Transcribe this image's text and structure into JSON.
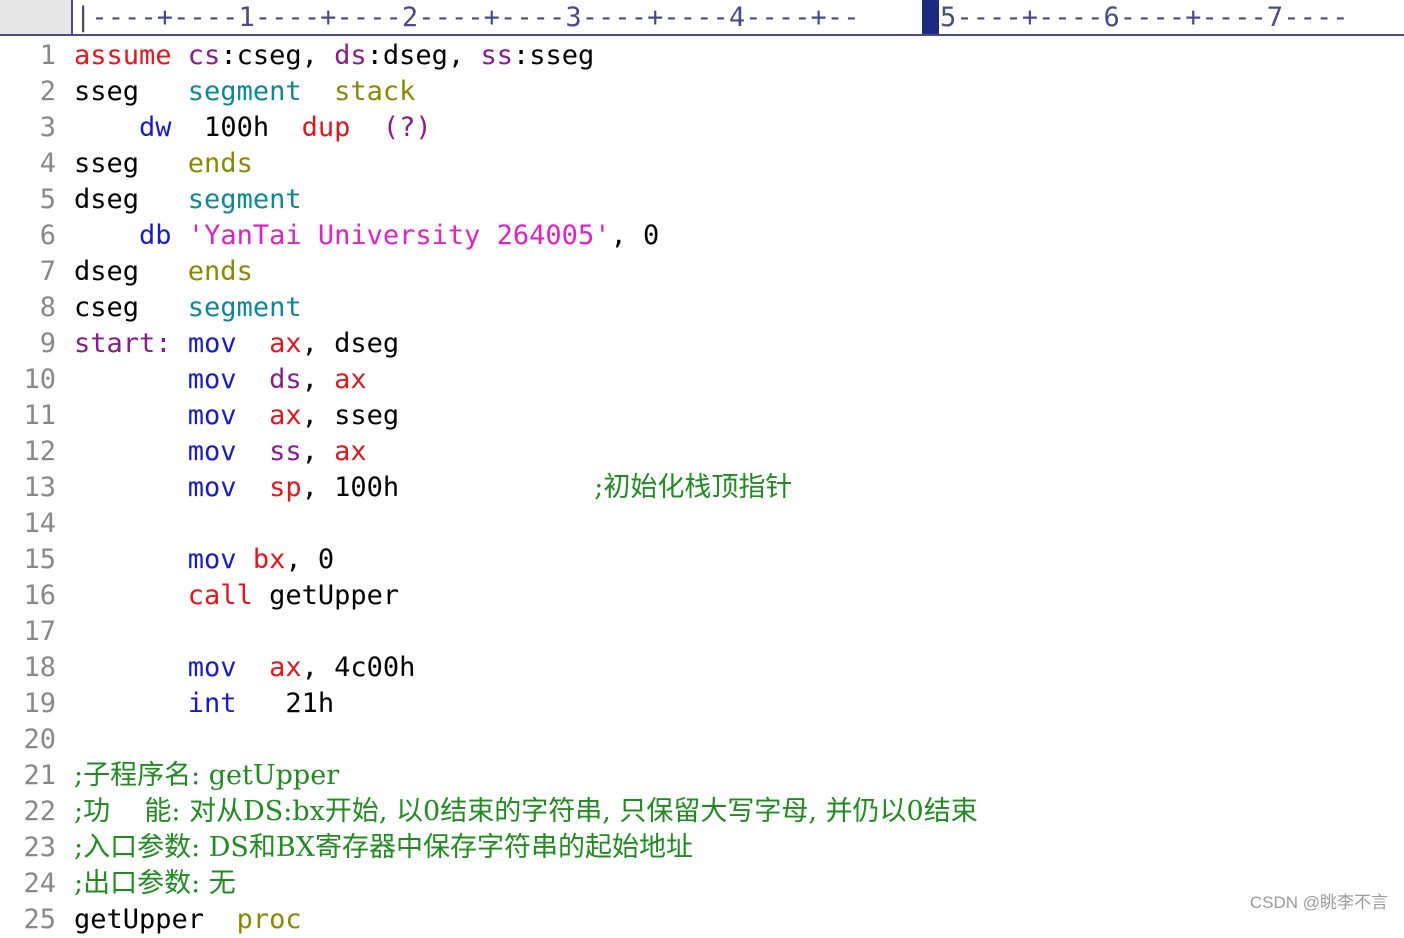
{
  "ruler": {
    "text": "|----+----1----+----2----+----3----+----4----+--",
    "text_after": "5----+----6----+----7----"
  },
  "colors": {
    "default": "#000000",
    "red": "#e8141c",
    "keyword": "#8a1a8c",
    "teal": "#0b8a96",
    "olive": "#8a8a00",
    "blue": "#1a1acc",
    "magenta": "#e020c8",
    "comment": "#1e8c1e",
    "line_number": "#888888"
  },
  "lines": [
    {
      "n": "1",
      "indent": 0,
      "tokens": [
        {
          "t": "assume",
          "c": "red"
        },
        {
          "t": " cs",
          "c": "keyword"
        },
        {
          "t": ":cseg",
          "c": "default"
        },
        {
          "t": ",",
          "c": "default"
        },
        {
          "t": " ds",
          "c": "keyword"
        },
        {
          "t": ":dseg",
          "c": "default"
        },
        {
          "t": ",",
          "c": "default"
        },
        {
          "t": " ss",
          "c": "keyword"
        },
        {
          "t": ":sseg",
          "c": "default"
        }
      ]
    },
    {
      "n": "2",
      "indent": 0,
      "tokens": [
        {
          "t": "sseg   ",
          "c": "default"
        },
        {
          "t": "segment",
          "c": "teal"
        },
        {
          "t": "  ",
          "c": "default"
        },
        {
          "t": "stack",
          "c": "olive"
        }
      ]
    },
    {
      "n": "3",
      "indent": 4,
      "tokens": [
        {
          "t": "dw",
          "c": "blue"
        },
        {
          "t": "  100h  ",
          "c": "default"
        },
        {
          "t": "dup",
          "c": "red"
        },
        {
          "t": "  ",
          "c": "default"
        },
        {
          "t": "(?)",
          "c": "keyword"
        }
      ]
    },
    {
      "n": "4",
      "indent": 0,
      "tokens": [
        {
          "t": "sseg   ",
          "c": "default"
        },
        {
          "t": "ends",
          "c": "olive"
        }
      ]
    },
    {
      "n": "5",
      "indent": 0,
      "tokens": [
        {
          "t": "dseg   ",
          "c": "default"
        },
        {
          "t": "segment",
          "c": "teal"
        }
      ]
    },
    {
      "n": "6",
      "indent": 4,
      "tokens": [
        {
          "t": "db",
          "c": "blue"
        },
        {
          "t": " ",
          "c": "default"
        },
        {
          "t": "'YanTai University 264005'",
          "c": "magenta"
        },
        {
          "t": ", 0",
          "c": "default"
        }
      ]
    },
    {
      "n": "7",
      "indent": 0,
      "tokens": [
        {
          "t": "dseg   ",
          "c": "default"
        },
        {
          "t": "ends",
          "c": "olive"
        }
      ]
    },
    {
      "n": "8",
      "indent": 0,
      "tokens": [
        {
          "t": "cseg   ",
          "c": "default"
        },
        {
          "t": "segment",
          "c": "teal"
        }
      ]
    },
    {
      "n": "9",
      "indent": 0,
      "tokens": [
        {
          "t": "start:",
          "c": "keyword"
        },
        {
          "t": " ",
          "c": "default"
        },
        {
          "t": "mov",
          "c": "blue"
        },
        {
          "t": "  ",
          "c": "default"
        },
        {
          "t": "ax",
          "c": "red"
        },
        {
          "t": ", dseg",
          "c": "default"
        }
      ]
    },
    {
      "n": "10",
      "indent": 7,
      "tokens": [
        {
          "t": "mov",
          "c": "blue"
        },
        {
          "t": "  ",
          "c": "default"
        },
        {
          "t": "ds",
          "c": "keyword"
        },
        {
          "t": ", ",
          "c": "default"
        },
        {
          "t": "ax",
          "c": "red"
        }
      ]
    },
    {
      "n": "11",
      "indent": 7,
      "tokens": [
        {
          "t": "mov",
          "c": "blue"
        },
        {
          "t": "  ",
          "c": "default"
        },
        {
          "t": "ax",
          "c": "red"
        },
        {
          "t": ", sseg",
          "c": "default"
        }
      ]
    },
    {
      "n": "12",
      "indent": 7,
      "tokens": [
        {
          "t": "mov",
          "c": "blue"
        },
        {
          "t": "  ",
          "c": "default"
        },
        {
          "t": "ss",
          "c": "keyword"
        },
        {
          "t": ", ",
          "c": "default"
        },
        {
          "t": "ax",
          "c": "red"
        }
      ]
    },
    {
      "n": "13",
      "indent": 7,
      "tokens": [
        {
          "t": "mov",
          "c": "blue"
        },
        {
          "t": "  ",
          "c": "default"
        },
        {
          "t": "sp",
          "c": "red"
        },
        {
          "t": ", 100h            ",
          "c": "default"
        },
        {
          "t": ";初始化栈顶指针",
          "c": "comment"
        }
      ]
    },
    {
      "n": "14",
      "indent": 0,
      "tokens": []
    },
    {
      "n": "15",
      "indent": 7,
      "tokens": [
        {
          "t": "mov",
          "c": "blue"
        },
        {
          "t": " ",
          "c": "default"
        },
        {
          "t": "bx",
          "c": "red"
        },
        {
          "t": ", 0",
          "c": "default"
        }
      ]
    },
    {
      "n": "16",
      "indent": 7,
      "tokens": [
        {
          "t": "call",
          "c": "red"
        },
        {
          "t": " getUpper",
          "c": "default"
        }
      ]
    },
    {
      "n": "17",
      "indent": 0,
      "tokens": []
    },
    {
      "n": "18",
      "indent": 7,
      "tokens": [
        {
          "t": "mov",
          "c": "blue"
        },
        {
          "t": "  ",
          "c": "default"
        },
        {
          "t": "ax",
          "c": "red"
        },
        {
          "t": ", 4c00h",
          "c": "default"
        }
      ]
    },
    {
      "n": "19",
      "indent": 7,
      "tokens": [
        {
          "t": "int",
          "c": "blue"
        },
        {
          "t": "   21h",
          "c": "default"
        }
      ]
    },
    {
      "n": "20",
      "indent": 0,
      "tokens": []
    },
    {
      "n": "21",
      "indent": 0,
      "tokens": [
        {
          "t": ";子程序名: getUpper",
          "c": "comment"
        }
      ]
    },
    {
      "n": "22",
      "indent": 0,
      "tokens": [
        {
          "t": ";功    能: 对从DS:bx开始, 以0结束的字符串, 只保留大写字母, 并仍以0结束",
          "c": "comment"
        }
      ]
    },
    {
      "n": "23",
      "indent": 0,
      "tokens": [
        {
          "t": ";入口参数: DS和BX寄存器中保存字符串的起始地址",
          "c": "comment"
        }
      ]
    },
    {
      "n": "24",
      "indent": 0,
      "tokens": [
        {
          "t": ";出口参数: 无",
          "c": "comment"
        }
      ]
    },
    {
      "n": "25",
      "indent": 0,
      "tokens": [
        {
          "t": "getUpper  ",
          "c": "default"
        },
        {
          "t": "proc",
          "c": "olive"
        }
      ]
    }
  ],
  "watermark": "CSDN @眺李不言"
}
